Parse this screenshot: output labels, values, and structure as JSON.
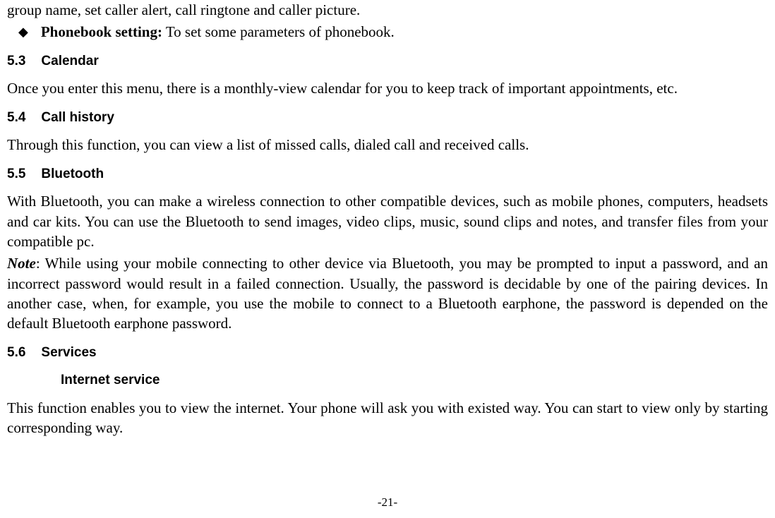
{
  "fragment_line": "group name, set caller alert, call ringtone and caller picture.",
  "phonebook_bullet": {
    "label": "Phonebook setting:",
    "desc": " To set some parameters of phonebook."
  },
  "sec53": {
    "num": "5.3",
    "title": "Calendar",
    "body": "Once you enter this menu, there is a monthly-view calendar for you to keep track of important appointments, etc."
  },
  "sec54": {
    "num": "5.4",
    "title": "Call history",
    "body": "Through this function, you can view a list of missed calls, dialed call and received calls."
  },
  "sec55": {
    "num": "5.5",
    "title": "Bluetooth",
    "body": "With Bluetooth, you can make a wireless connection to other compatible devices, such as mobile phones, computers, headsets and car kits. You can use the Bluetooth to send images, video clips, music, sound clips and notes, and transfer files from your compatible pc.",
    "note_label": "Note",
    "note_body": ": While using your mobile connecting to other device via Bluetooth, you may be prompted to input a password, and an incorrect password would result in a failed connection. Usually, the password is decidable by one of the pairing devices. In another case, when, for example, you use the mobile to connect to a Bluetooth earphone, the password is depended on the default Bluetooth earphone password."
  },
  "sec56": {
    "num": "5.6",
    "title": "Services",
    "sub": "Internet service",
    "body": "This function enables you to view the internet. Your phone will ask you with existed way. You can start to view only by starting corresponding way."
  },
  "page_number": "-21-"
}
